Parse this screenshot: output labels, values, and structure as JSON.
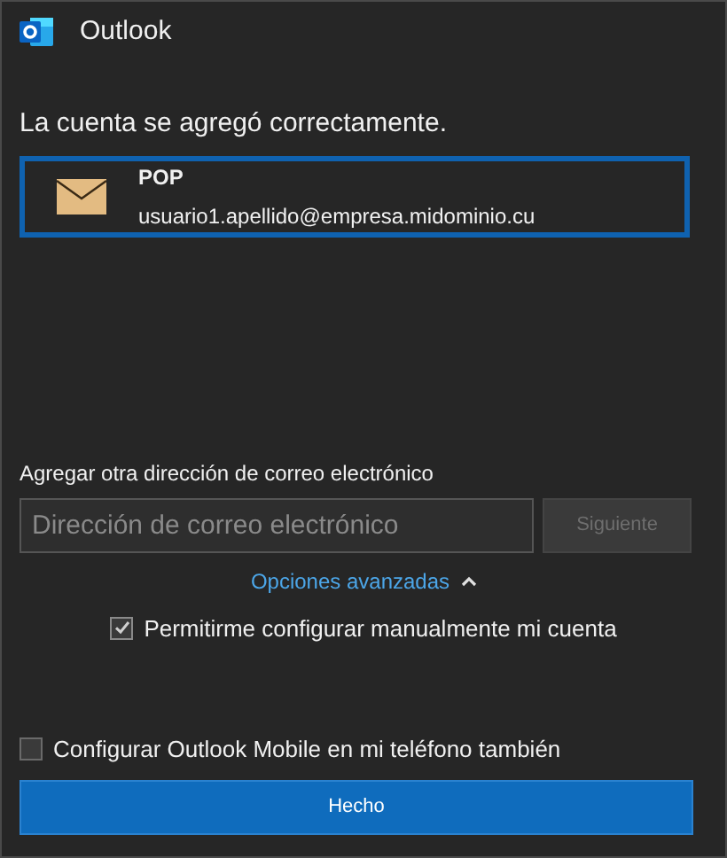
{
  "window": {
    "title": "Outlook"
  },
  "heading": "La cuenta se agregó correctamente.",
  "account": {
    "type": "POP",
    "email": "usuario1.apellido@empresa.midominio.cu",
    "selected": true
  },
  "add_email": {
    "label": "Agregar otra dirección de correo electrónico",
    "placeholder": "Dirección de correo electrónico",
    "button": {
      "label": "Siguiente",
      "disabled": true
    }
  },
  "advanced_options": {
    "label": "Opciones avanzadas",
    "expanded": true
  },
  "manual_setup": {
    "label": "Permitirme configurar manualmente mi cuenta",
    "checked": true
  },
  "mobile_setup": {
    "label": "Configurar Outlook Mobile en mi teléfono también",
    "checked": false
  },
  "done_button": {
    "label": "Hecho"
  }
}
